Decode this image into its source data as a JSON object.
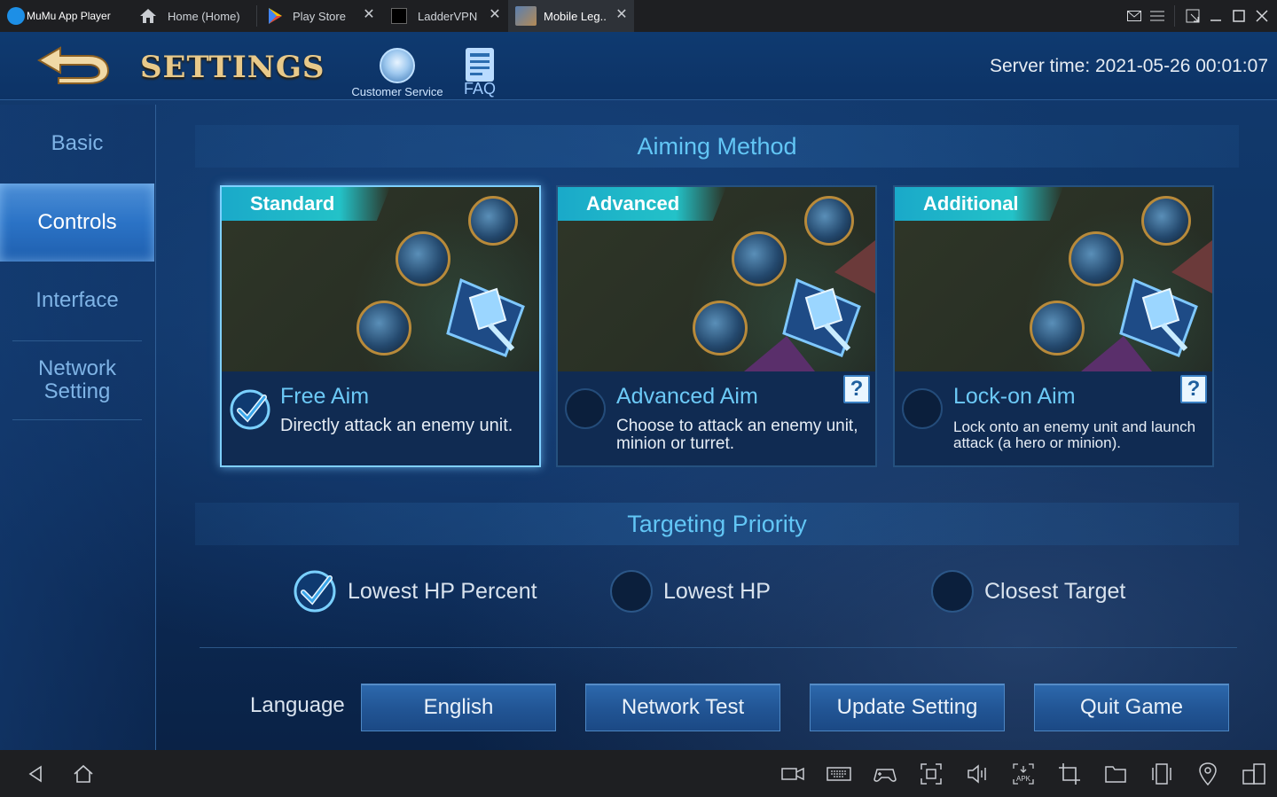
{
  "titlebar": {
    "app_name": "MuMu App Player",
    "tabs": [
      {
        "label": "Home (Home)"
      },
      {
        "label": "Play Store"
      },
      {
        "label": "LadderVPN"
      },
      {
        "label": "Mobile Leg.."
      }
    ],
    "close_glyph": "✕"
  },
  "header": {
    "title": "SETTINGS",
    "customer_service": "Customer Service",
    "faq": "FAQ",
    "server_time": "Server time: 2021-05-26 00:01:07"
  },
  "sidebar": {
    "items": [
      {
        "label": "Basic",
        "active": false
      },
      {
        "label": "Controls",
        "active": true
      },
      {
        "label": "Interface",
        "active": false
      },
      {
        "label": "Network Setting",
        "active": false
      }
    ]
  },
  "aiming": {
    "heading": "Aiming Method",
    "cards": [
      {
        "tag": "Standard",
        "name": "Free Aim",
        "desc": "Directly attack an enemy unit.",
        "selected": true
      },
      {
        "tag": "Advanced",
        "name": "Advanced Aim",
        "desc": "Choose to attack an enemy unit, minion or turret.",
        "selected": false,
        "help": "?"
      },
      {
        "tag": "Additional",
        "name": "Lock-on Aim",
        "desc": "Lock onto an enemy unit and launch attack (a hero or minion).",
        "selected": false,
        "help": "?"
      }
    ]
  },
  "targeting": {
    "heading": "Targeting Priority",
    "options": [
      {
        "label": "Lowest HP Percent",
        "selected": true
      },
      {
        "label": "Lowest HP",
        "selected": false
      },
      {
        "label": "Closest Target",
        "selected": false
      }
    ]
  },
  "footer": {
    "language_label": "Language",
    "buttons": [
      "English",
      "Network Test",
      "Update Setting",
      "Quit Game"
    ]
  },
  "colors": {
    "accent": "#62c6f5",
    "title_gold": "#e8c98a",
    "button_blue": "#225696"
  }
}
